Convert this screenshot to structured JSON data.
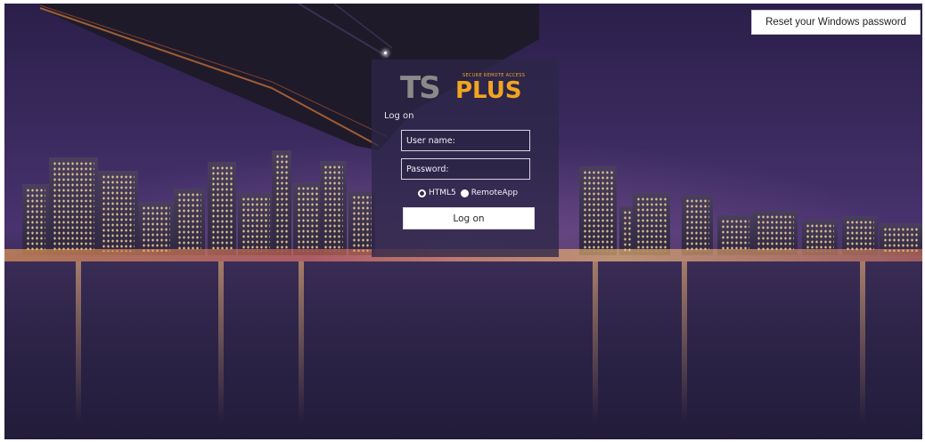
{
  "header": {
    "reset_password_label": "Reset your Windows password"
  },
  "logo": {
    "ts": "TS",
    "plus": "PLUS",
    "tagline": "SECURE REMOTE ACCESS",
    "brand_color": "#f2a51f"
  },
  "login": {
    "title": "Log on",
    "username": {
      "value": "",
      "placeholder": "User name:"
    },
    "password": {
      "value": "",
      "placeholder": "Password:"
    },
    "options": [
      {
        "label": "HTML5",
        "selected": false
      },
      {
        "label": "RemoteApp",
        "selected": true
      }
    ],
    "submit_label": "Log on"
  }
}
